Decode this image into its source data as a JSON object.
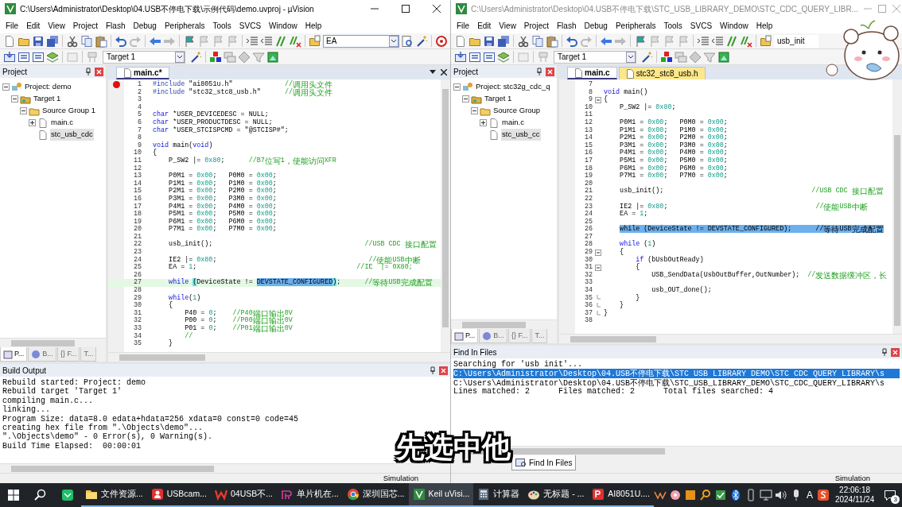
{
  "windows": [
    {
      "title": "C:\\Users\\Administrator\\Desktop\\04.USB不停电下载\\示例代码\\demo.uvproj - µVision",
      "active": true,
      "menu": [
        "File",
        "Edit",
        "View",
        "Project",
        "Flash",
        "Debug",
        "Peripherals",
        "Tools",
        "SVCS",
        "Window",
        "Help"
      ],
      "find_field": {
        "value": "EA"
      },
      "target": "Target 1",
      "project_panel": {
        "title": "Project",
        "tree": [
          {
            "kind": "project",
            "label": "Project: demo",
            "expanded": true,
            "selected": false,
            "children": [
              {
                "kind": "target",
                "label": "Target 1",
                "expanded": true,
                "selected": false,
                "children": [
                  {
                    "kind": "group",
                    "label": "Source Group 1",
                    "expanded": true,
                    "selected": false,
                    "children": [
                      {
                        "kind": "file",
                        "label": "main.c",
                        "expanded": false,
                        "selected": false
                      },
                      {
                        "kind": "file",
                        "label": "stc_usb_cdc",
                        "selected": true
                      }
                    ]
                  }
                ]
              }
            ]
          }
        ],
        "tabs": [
          {
            "label": "P...",
            "selected": true
          },
          {
            "label": "B...",
            "selected": false
          },
          {
            "label": "{} F...",
            "selected": false
          },
          {
            "label": "T...",
            "selected": false
          }
        ]
      },
      "editor": {
        "tabs": [
          {
            "label": "main.c*",
            "selected": true,
            "color": "#ffffff"
          }
        ],
        "lines": [
          {
            "num": "1",
            "breakpoint": true,
            "parts": [
              {
                "kind": "directive",
                "text": "#include"
              },
              {
                "kind": "plain",
                "text": " \"ai8051u.h\"             "
              },
              {
                "kind": "comment",
                "text": "//调用头文件"
              }
            ]
          },
          {
            "num": "2",
            "parts": [
              {
                "kind": "directive",
                "text": "#include"
              },
              {
                "kind": "plain",
                "text": " \"stc32_stc8_usb.h\"      "
              },
              {
                "kind": "comment",
                "text": "//调用头文件"
              }
            ]
          },
          {
            "num": "3"
          },
          {
            "num": "4"
          },
          {
            "num": "5",
            "parts": [
              {
                "kind": "keyword",
                "text": "char"
              },
              {
                "kind": "plain",
                "text": " *USER_DEVICEDESC = NULL;"
              }
            ]
          },
          {
            "num": "6",
            "parts": [
              {
                "kind": "keyword",
                "text": "char"
              },
              {
                "kind": "plain",
                "text": " *USER_PRODUCTDESC = NULL;"
              }
            ]
          },
          {
            "num": "7",
            "parts": [
              {
                "kind": "keyword",
                "text": "char"
              },
              {
                "kind": "plain",
                "text": " *USER_STCISPCMD = \"@STCISP#\";"
              }
            ]
          },
          {
            "num": "8"
          },
          {
            "num": "9",
            "parts": [
              {
                "kind": "keyword",
                "text": "void"
              },
              {
                "kind": "plain",
                "text": " main("
              },
              {
                "kind": "keyword",
                "text": "void"
              },
              {
                "kind": "plain",
                "text": ")"
              }
            ]
          },
          {
            "num": "10",
            "parts": [
              {
                "kind": "plain",
                "text": "{"
              }
            ]
          },
          {
            "num": "11",
            "parts": [
              {
                "kind": "plain",
                "text": "    P_SW2 |= "
              },
              {
                "kind": "number",
                "text": "0x80"
              },
              {
                "kind": "plain",
                "text": ";      "
              },
              {
                "kind": "comment",
                "text": "//B7位写1，使能访问XFR"
              }
            ]
          },
          {
            "num": "12"
          },
          {
            "num": "13",
            "parts": [
              {
                "kind": "plain",
                "text": "    P0M1 = "
              },
              {
                "kind": "number",
                "text": "0x00"
              },
              {
                "kind": "plain",
                "text": ";   P0M0 = "
              },
              {
                "kind": "number",
                "text": "0x00"
              },
              {
                "kind": "plain",
                "text": ";"
              }
            ]
          },
          {
            "num": "14",
            "parts": [
              {
                "kind": "plain",
                "text": "    P1M1 = "
              },
              {
                "kind": "number",
                "text": "0x00"
              },
              {
                "kind": "plain",
                "text": ";   P1M0 = "
              },
              {
                "kind": "number",
                "text": "0x00"
              },
              {
                "kind": "plain",
                "text": ";"
              }
            ]
          },
          {
            "num": "15",
            "parts": [
              {
                "kind": "plain",
                "text": "    P2M1 = "
              },
              {
                "kind": "number",
                "text": "0x00"
              },
              {
                "kind": "plain",
                "text": ";   P2M0 = "
              },
              {
                "kind": "number",
                "text": "0x00"
              },
              {
                "kind": "plain",
                "text": ";"
              }
            ]
          },
          {
            "num": "16",
            "parts": [
              {
                "kind": "plain",
                "text": "    P3M1 = "
              },
              {
                "kind": "number",
                "text": "0x00"
              },
              {
                "kind": "plain",
                "text": ";   P3M0 = "
              },
              {
                "kind": "number",
                "text": "0x00"
              },
              {
                "kind": "plain",
                "text": ";"
              }
            ]
          },
          {
            "num": "17",
            "parts": [
              {
                "kind": "plain",
                "text": "    P4M1 = "
              },
              {
                "kind": "number",
                "text": "0x00"
              },
              {
                "kind": "plain",
                "text": ";   P4M0 = "
              },
              {
                "kind": "number",
                "text": "0x00"
              },
              {
                "kind": "plain",
                "text": ";"
              }
            ]
          },
          {
            "num": "18",
            "parts": [
              {
                "kind": "plain",
                "text": "    P5M1 = "
              },
              {
                "kind": "number",
                "text": "0x00"
              },
              {
                "kind": "plain",
                "text": ";   P5M0 = "
              },
              {
                "kind": "number",
                "text": "0x00"
              },
              {
                "kind": "plain",
                "text": ";"
              }
            ]
          },
          {
            "num": "19",
            "parts": [
              {
                "kind": "plain",
                "text": "    P6M1 = "
              },
              {
                "kind": "number",
                "text": "0x00"
              },
              {
                "kind": "plain",
                "text": ";   P6M0 = "
              },
              {
                "kind": "number",
                "text": "0x00"
              },
              {
                "kind": "plain",
                "text": ";"
              }
            ]
          },
          {
            "num": "20",
            "parts": [
              {
                "kind": "plain",
                "text": "    P7M1 = "
              },
              {
                "kind": "number",
                "text": "0x00"
              },
              {
                "kind": "plain",
                "text": ";   P7M0 = "
              },
              {
                "kind": "number",
                "text": "0x00"
              },
              {
                "kind": "plain",
                "text": ";"
              }
            ]
          },
          {
            "num": "21"
          },
          {
            "num": "22",
            "parts": [
              {
                "kind": "plain",
                "text": "    usb_init();                                      "
              },
              {
                "kind": "comment",
                "text": "//USB CDC 接口配置"
              }
            ]
          },
          {
            "num": "23"
          },
          {
            "num": "24",
            "parts": [
              {
                "kind": "plain",
                "text": "    IE2 |= "
              },
              {
                "kind": "number",
                "text": "0x80"
              },
              {
                "kind": "plain",
                "text": ";                                      "
              },
              {
                "kind": "comment",
                "text": "//使能USB中断"
              }
            ]
          },
          {
            "num": "25",
            "parts": [
              {
                "kind": "plain",
                "text": "    EA = "
              },
              {
                "kind": "number",
                "text": "1"
              },
              {
                "kind": "plain",
                "text": ";                                        "
              },
              {
                "kind": "comment",
                "text": "//IE  |= 0X80;"
              }
            ]
          },
          {
            "num": "26"
          },
          {
            "num": "27",
            "current": true,
            "parts": [
              {
                "kind": "keyword",
                "text": "    while "
              },
              {
                "kind": "brace-match",
                "text": "("
              },
              {
                "kind": "plain",
                "text": "DeviceState != "
              },
              {
                "kind": "selection",
                "text": "DEVSTATE_CONFIGURED"
              },
              {
                "kind": "brace-match",
                "text": ")"
              },
              {
                "kind": "plain",
                "text": ";      "
              },
              {
                "kind": "comment",
                "text": "//等待USB完成配置"
              }
            ]
          },
          {
            "num": "28"
          },
          {
            "num": "29",
            "parts": [
              {
                "kind": "keyword",
                "text": "    while"
              },
              {
                "kind": "plain",
                "text": "("
              },
              {
                "kind": "number",
                "text": "1"
              },
              {
                "kind": "plain",
                "text": ")"
              }
            ]
          },
          {
            "num": "30",
            "parts": [
              {
                "kind": "plain",
                "text": "    {"
              }
            ]
          },
          {
            "num": "31",
            "parts": [
              {
                "kind": "plain",
                "text": "        P40 = "
              },
              {
                "kind": "number",
                "text": "0"
              },
              {
                "kind": "plain",
                "text": ";    "
              },
              {
                "kind": "comment",
                "text": "//P40端口输出0V"
              }
            ]
          },
          {
            "num": "32",
            "parts": [
              {
                "kind": "plain",
                "text": "        P00 = "
              },
              {
                "kind": "number",
                "text": "0"
              },
              {
                "kind": "plain",
                "text": ";    "
              },
              {
                "kind": "comment",
                "text": "//P00端口输出0V"
              }
            ]
          },
          {
            "num": "33",
            "parts": [
              {
                "kind": "plain",
                "text": "        P01 = "
              },
              {
                "kind": "number",
                "text": "0"
              },
              {
                "kind": "plain",
                "text": ";    "
              },
              {
                "kind": "comment",
                "text": "//P01端口输出0V"
              }
            ]
          },
          {
            "num": "34",
            "parts": [
              {
                "kind": "comment",
                "text": "        //"
              }
            ]
          },
          {
            "num": "35",
            "parts": [
              {
                "kind": "plain",
                "text": "    }"
              }
            ]
          }
        ]
      },
      "output": {
        "title": "Build Output",
        "lines": [
          {
            "text": "Rebuild started: Project: demo",
            "selected": false
          },
          {
            "text": "Rebuild target 'Target 1'",
            "selected": false
          },
          {
            "text": "compiling main.c...",
            "selected": false
          },
          {
            "text": "linking...",
            "selected": false
          },
          {
            "text": "Program Size: data=8.0 edata+hdata=256 xdata=0 const=0 code=45",
            "selected": false
          },
          {
            "text": "creating hex file from \".\\Objects\\demo\"...",
            "selected": false
          },
          {
            "text": "\".\\Objects\\demo\" - 0 Error(s), 0 Warning(s).",
            "selected": false
          },
          {
            "text": "Build Time Elapsed:  00:00:01",
            "selected": false
          }
        ]
      },
      "status": "Simulation"
    },
    {
      "title": "C:\\Users\\Administrator\\Desktop\\04.USB不停电下载\\STC_USB_LIBRARY_DEMO\\STC_CDC_QUERY_LIBR...",
      "active": false,
      "menu": [
        "File",
        "Edit",
        "View",
        "Project",
        "Flash",
        "Debug",
        "Peripherals",
        "Tools",
        "SVCS",
        "Window",
        "Help"
      ],
      "find_field": {
        "value": "usb_init"
      },
      "target": "Target 1",
      "project_panel": {
        "title": "Project",
        "tree": [
          {
            "kind": "project",
            "label": "Project: stc32g_cdc_q",
            "expanded": true,
            "selected": false,
            "children": [
              {
                "kind": "target",
                "label": "Target 1",
                "expanded": true,
                "selected": false,
                "children": [
                  {
                    "kind": "group",
                    "label": "Source Group",
                    "expanded": true,
                    "selected": false,
                    "children": [
                      {
                        "kind": "file",
                        "label": "main.c",
                        "expanded": false,
                        "selected": false
                      },
                      {
                        "kind": "file",
                        "label": "stc_usb_cc",
                        "selected": true
                      }
                    ]
                  }
                ]
              }
            ]
          }
        ],
        "tabs": [
          {
            "label": "P...",
            "selected": true
          },
          {
            "label": "B...",
            "selected": false
          },
          {
            "label": "{} F...",
            "selected": false
          },
          {
            "label": "T...",
            "selected": false
          }
        ]
      },
      "editor": {
        "tabs": [
          {
            "label": "main.c",
            "selected": true,
            "color": "#ffffff"
          },
          {
            "label": "stc32_stc8_usb.h",
            "selected": false,
            "color": "#fde78c"
          }
        ],
        "lines": [
          {
            "num": "7"
          },
          {
            "num": "8",
            "parts": [
              {
                "kind": "keyword",
                "text": "void"
              },
              {
                "kind": "plain",
                "text": " main()"
              }
            ]
          },
          {
            "num": "9",
            "fold_start": true,
            "parts": [
              {
                "kind": "plain",
                "text": "{"
              }
            ]
          },
          {
            "num": "10",
            "parts": [
              {
                "kind": "plain",
                "text": "    P_SW2 |= "
              },
              {
                "kind": "number",
                "text": "0x80"
              },
              {
                "kind": "plain",
                "text": ";"
              }
            ]
          },
          {
            "num": "11"
          },
          {
            "num": "12",
            "parts": [
              {
                "kind": "plain",
                "text": "    P0M1 = "
              },
              {
                "kind": "number",
                "text": "0x00"
              },
              {
                "kind": "plain",
                "text": ";   P0M0 = "
              },
              {
                "kind": "number",
                "text": "0x00"
              },
              {
                "kind": "plain",
                "text": ";"
              }
            ]
          },
          {
            "num": "13",
            "parts": [
              {
                "kind": "plain",
                "text": "    P1M1 = "
              },
              {
                "kind": "number",
                "text": "0x00"
              },
              {
                "kind": "plain",
                "text": ";   P1M0 = "
              },
              {
                "kind": "number",
                "text": "0x00"
              },
              {
                "kind": "plain",
                "text": ";"
              }
            ]
          },
          {
            "num": "14",
            "parts": [
              {
                "kind": "plain",
                "text": "    P2M1 = "
              },
              {
                "kind": "number",
                "text": "0x00"
              },
              {
                "kind": "plain",
                "text": ";   P2M0 = "
              },
              {
                "kind": "number",
                "text": "0x00"
              },
              {
                "kind": "plain",
                "text": ";"
              }
            ]
          },
          {
            "num": "15",
            "parts": [
              {
                "kind": "plain",
                "text": "    P3M1 = "
              },
              {
                "kind": "number",
                "text": "0x00"
              },
              {
                "kind": "plain",
                "text": ";   P3M0 = "
              },
              {
                "kind": "number",
                "text": "0x00"
              },
              {
                "kind": "plain",
                "text": ";"
              }
            ]
          },
          {
            "num": "16",
            "parts": [
              {
                "kind": "plain",
                "text": "    P4M1 = "
              },
              {
                "kind": "number",
                "text": "0x00"
              },
              {
                "kind": "plain",
                "text": ";   P4M0 = "
              },
              {
                "kind": "number",
                "text": "0x00"
              },
              {
                "kind": "plain",
                "text": ";"
              }
            ]
          },
          {
            "num": "17",
            "parts": [
              {
                "kind": "plain",
                "text": "    P5M1 = "
              },
              {
                "kind": "number",
                "text": "0x00"
              },
              {
                "kind": "plain",
                "text": ";   P5M0 = "
              },
              {
                "kind": "number",
                "text": "0x00"
              },
              {
                "kind": "plain",
                "text": ";"
              }
            ]
          },
          {
            "num": "18",
            "parts": [
              {
                "kind": "plain",
                "text": "    P6M1 = "
              },
              {
                "kind": "number",
                "text": "0x00"
              },
              {
                "kind": "plain",
                "text": ";   P6M0 = "
              },
              {
                "kind": "number",
                "text": "0x00"
              },
              {
                "kind": "plain",
                "text": ";"
              }
            ]
          },
          {
            "num": "19",
            "parts": [
              {
                "kind": "plain",
                "text": "    P7M1 = "
              },
              {
                "kind": "number",
                "text": "0x00"
              },
              {
                "kind": "plain",
                "text": ";   P7M0 = "
              },
              {
                "kind": "number",
                "text": "0x00"
              },
              {
                "kind": "plain",
                "text": ";"
              }
            ]
          },
          {
            "num": "20"
          },
          {
            "num": "21",
            "parts": [
              {
                "kind": "plain",
                "text": "    usb_init();                                     "
              },
              {
                "kind": "comment",
                "text": "//USB CDC 接口配置"
              }
            ]
          },
          {
            "num": "22"
          },
          {
            "num": "23",
            "parts": [
              {
                "kind": "plain",
                "text": "    IE2 |= "
              },
              {
                "kind": "number",
                "text": "0x80"
              },
              {
                "kind": "plain",
                "text": ";                                     "
              },
              {
                "kind": "comment",
                "text": "//使能USB中断"
              }
            ]
          },
          {
            "num": "24",
            "parts": [
              {
                "kind": "plain",
                "text": "    EA = "
              },
              {
                "kind": "number",
                "text": "1"
              },
              {
                "kind": "plain",
                "text": ";"
              }
            ]
          },
          {
            "num": "25"
          },
          {
            "num": "26",
            "parts": [
              {
                "kind": "selection",
                "text": "    while (DeviceState != DEVSTATE_CONFIGURED);      //等待USB完成配置"
              }
            ]
          },
          {
            "num": "27"
          },
          {
            "num": "28",
            "parts": [
              {
                "kind": "keyword",
                "text": "    while"
              },
              {
                "kind": "plain",
                "text": " ("
              },
              {
                "kind": "number",
                "text": "1"
              },
              {
                "kind": "plain",
                "text": ")"
              }
            ]
          },
          {
            "num": "29",
            "fold_start": true,
            "parts": [
              {
                "kind": "plain",
                "text": "    {"
              }
            ]
          },
          {
            "num": "30",
            "parts": [
              {
                "kind": "keyword",
                "text": "        if"
              },
              {
                "kind": "plain",
                "text": " (bUsbOutReady)"
              }
            ]
          },
          {
            "num": "31",
            "fold_start": true,
            "parts": [
              {
                "kind": "plain",
                "text": "        {"
              }
            ]
          },
          {
            "num": "32",
            "parts": [
              {
                "kind": "plain",
                "text": "            USB_SendData(UsbOutBuffer,OutNumber);  "
              },
              {
                "kind": "comment",
                "text": "//发送数据缓冲区，长"
              }
            ]
          },
          {
            "num": "33"
          },
          {
            "num": "34",
            "parts": [
              {
                "kind": "plain",
                "text": "            usb_OUT_done();"
              }
            ]
          },
          {
            "num": "35",
            "fold_end": true,
            "parts": [
              {
                "kind": "plain",
                "text": "        }"
              }
            ]
          },
          {
            "num": "36",
            "fold_end": true,
            "parts": [
              {
                "kind": "plain",
                "text": "    }"
              }
            ]
          },
          {
            "num": "37",
            "fold_end": true,
            "parts": [
              {
                "kind": "plain",
                "text": "}"
              }
            ]
          },
          {
            "num": "38"
          }
        ]
      },
      "output": {
        "title": "Find In Files",
        "lines": [
          {
            "text": "Searching for 'usb init'...",
            "selected": false
          },
          {
            "text": "C:\\Users\\Administrator\\Desktop\\04.USB不停电下载\\STC USB LIBRARY DEMO\\STC CDC QUERY LIBRARY\\s",
            "selected": true
          },
          {
            "text": "C:\\Users\\Administrator\\Desktop\\04.USB不停电下载\\STC_USB_LIBRARY_DEMO\\STC_CDC_QUERY_LIBRARY\\s",
            "selected": false
          },
          {
            "text": "Lines matched: 2      Files matched: 2      Total files searched: 4",
            "selected": false
          }
        ],
        "tabs": [
          {
            "label": "Find In Files",
            "selected": true
          }
        ]
      },
      "status": "Simulation"
    }
  ],
  "subtitle": "先选中他",
  "taskbar": {
    "apps": [
      {
        "label": "文件资源...",
        "selected": false
      },
      {
        "label": "USBcam...",
        "selected": false
      },
      {
        "label": "04USB不...",
        "selected": false
      },
      {
        "label": "单片机在...",
        "selected": false
      },
      {
        "label": "深圳国芯...",
        "selected": false
      },
      {
        "label": "Keil uVisi...",
        "selected": true
      },
      {
        "label": "计算器",
        "selected": false
      },
      {
        "label": "无标题 - ...",
        "selected": false
      },
      {
        "label": "AI8051U....",
        "selected": false
      }
    ],
    "tray_text": "A",
    "time": "22:06:18",
    "date": "2024/11/24",
    "notifications": "3"
  }
}
